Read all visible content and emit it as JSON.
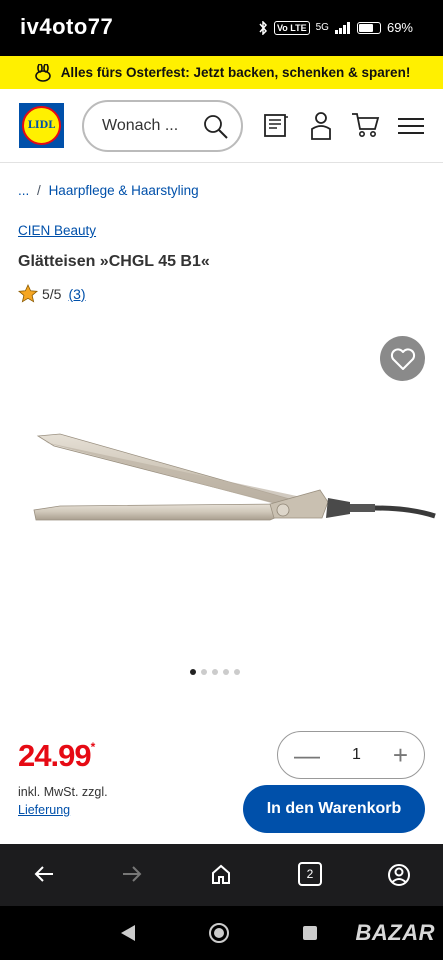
{
  "status_bar": {
    "carrier": "iv4oto77",
    "network": "5G",
    "volte": "Vo LTE",
    "battery": "69%"
  },
  "promo": {
    "text": "Alles fürs Osterfest: Jetzt backen, schenken & sparen!"
  },
  "header": {
    "logo": "LIDL",
    "search_placeholder": "Wonach ..."
  },
  "breadcrumb": {
    "ellipsis": "...",
    "separator": "/",
    "category": "Haarpflege & Haarstyling"
  },
  "product": {
    "brand": "CIEN Beauty",
    "title": "Glätteisen »CHGL 45 B1«",
    "rating": "5/5",
    "review_count": "(3)",
    "gallery_total": 5,
    "gallery_active": 1
  },
  "buy_box": {
    "price": "24.99",
    "price_mark": "*",
    "vat_note": "inkl. MwSt. zzgl.",
    "delivery_link": "Lieferung",
    "quantity": "1",
    "minus": "—",
    "plus": "+",
    "add_to_cart": "In den Warenkorb"
  },
  "browser": {
    "tab_count": "2"
  },
  "watermark": "BAZAR",
  "colors": {
    "brand_blue": "#0050aa",
    "promo_yellow": "#fff000",
    "price_red": "#e60a14"
  }
}
